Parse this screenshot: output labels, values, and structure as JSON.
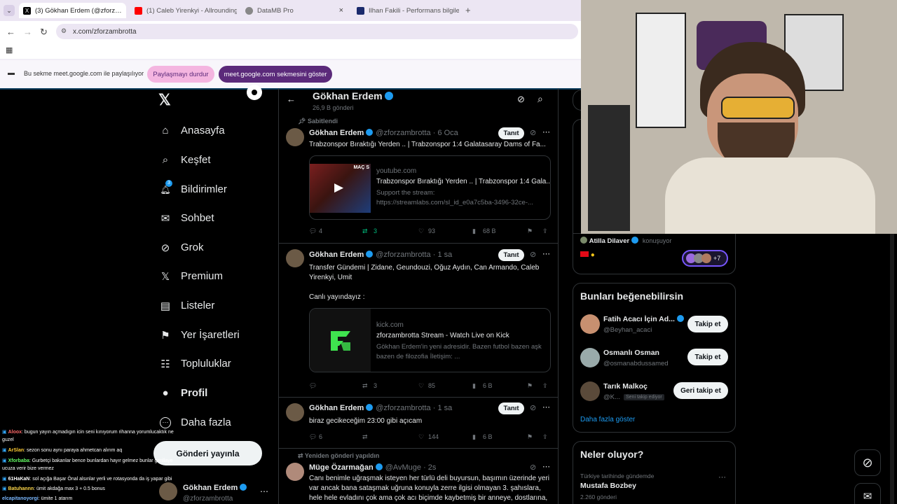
{
  "browser": {
    "tabs": [
      {
        "label": "(3) Gökhan Erdem (@zforz…",
        "favicon_color": "#000000"
      },
      {
        "label": "(1) Caleb Yirenkyi - Allrounding",
        "favicon_color": "#ff0000"
      },
      {
        "label": "DataMB Pro",
        "favicon_color": "#777777"
      },
      {
        "label": "Ilhan Fakili - Performans bilgile…",
        "favicon_color": "#1a2a6c"
      }
    ],
    "new_tab": "+",
    "url": "x.com/zforzambrotta",
    "share_text": "Bu sekme meet.google.com ile paylaşılıyor",
    "stop_share_label": "Paylaşmayı durdur",
    "show_tab_label": "meet.google.com sekmesini göster"
  },
  "sidebar": {
    "items": [
      {
        "label": "Anasayfa",
        "icon": "home-icon",
        "glyph": "⌂"
      },
      {
        "label": "Keşfet",
        "icon": "search-icon",
        "glyph": "⌕"
      },
      {
        "label": "Bildirimler",
        "icon": "bell-icon",
        "glyph": "🔔︎"
      },
      {
        "label": "Sohbet",
        "icon": "mail-icon",
        "glyph": "✉"
      },
      {
        "label": "Grok",
        "icon": "grok-icon",
        "glyph": "⊘"
      },
      {
        "label": "Premium",
        "icon": "x-logo-icon",
        "glyph": "𝕏"
      },
      {
        "label": "Listeler",
        "icon": "list-icon",
        "glyph": "▤"
      },
      {
        "label": "Yer İşaretleri",
        "icon": "bookmark-icon",
        "glyph": "⚑"
      },
      {
        "label": "Topluluklar",
        "icon": "community-icon",
        "glyph": "☷"
      },
      {
        "label": "Profil",
        "icon": "profile-icon",
        "glyph": "●"
      },
      {
        "label": "Daha fazla",
        "icon": "more-icon",
        "glyph": "⋯"
      }
    ],
    "notification_badge": "3",
    "post_button": "Gönderi yayınla",
    "account_name": "Gökhan Erdem",
    "account_handle": "@zforzambrotta"
  },
  "profile_header": {
    "name": "Gökhan Erdem",
    "posts_count": "26,9 B gönderi"
  },
  "tweets": [
    {
      "pinned_label": "Sabitlendi",
      "name": "Gökhan Erdem",
      "handle": "@zforzambrotta",
      "time": "· 6 Oca",
      "tanit": "Tanıt",
      "text": "Trabzonspor Bıraktığı Yerden .. | Trabzonspor 1:4 Galatasaray Dams of Fa...",
      "card": {
        "domain": "youtube.com",
        "title": "Trabzonspor Bıraktığı Yerden .. | Trabzonspor 1:4 Gala...",
        "desc": "Support the stream: https://streamlabs.com/sl_id_e0a7c5ba-3496-32ce-...",
        "thumb_text": "MAÇ S"
      },
      "replies": "4",
      "reposts": "3",
      "likes": "93",
      "views": "68 B"
    },
    {
      "name": "Gökhan Erdem",
      "handle": "@zforzambrotta",
      "time": "· 1 sa",
      "tanit": "Tanıt",
      "text1": "Transfer Gündemi | Zidane, Geundouzi, Oğuz Aydın, Can Armando, Caleb Yirenkyi, Umit",
      "text2": "Canlı yayındayız :",
      "card": {
        "domain": "kick.com",
        "title": "zforzambrotta Stream - Watch Live on Kick",
        "desc": "Gökhan Erdem'in yeni adresidir. Bazen futbol bazen aşk bazen de filozofia İletişim: ..."
      },
      "replies": "",
      "reposts": "3",
      "likes": "85",
      "views": "6 B"
    },
    {
      "name": "Gökhan Erdem",
      "handle": "@zforzambrotta",
      "time": "· 1 sa",
      "tanit": "Tanıt",
      "text": "biraz gecikeceğim 23:00 gibi açıcam",
      "replies": "6",
      "reposts": "",
      "likes": "144",
      "views": "6 B"
    },
    {
      "repost_label": "Yeniden gönderi yapıldın",
      "name": "Müge Özarmağan",
      "handle": "@AvMuge",
      "time": "· 2s",
      "text": "Canı benimle uğraşmak isteyen her türlü deli buyursun, başımın üzerinde yeri var ancak bana sataşmak uğruna konuyla zerre ilgisi olmayan 3. şahıslara, hele hele evladını çok ama çok acı biçimde kaybetmiş bir anneye, dostlarına,"
    }
  ],
  "spaces": {
    "host": "Atilla Dilaver",
    "status": "konuşuyor",
    "extra_count": "+7"
  },
  "who_to_follow": {
    "title": "Bunları beğenebilirsin",
    "users": [
      {
        "name": "Fatih Acacı İçin Ad...",
        "handle": "@Beyhan_acaci",
        "button": "Takip et"
      },
      {
        "name": "Osmanlı Osman",
        "handle": "@osmanabdussamed",
        "button": "Takip et"
      },
      {
        "name": "Tarık Malkoç",
        "handle": "@K...",
        "follows_you": "Seni takip ediyor",
        "button": "Geri takip et"
      }
    ],
    "show_more": "Daha fazla göster"
  },
  "trends": {
    "title": "Neler oluyor?",
    "context": "Türkiye tarihinde gündemde",
    "topic": "Mustafa Bozbey",
    "count": "2.260 gönderi"
  },
  "chat": [
    {
      "user": "Aloox",
      "msg": ": bugun yayın açmadıgın icin seni kınıyorum rihanna yorumlucaktık ne",
      "cont": "guzel"
    },
    {
      "user": "ArSlan",
      "msg": ": sezon sonu aynı paraya ahmetcan alırım aq"
    },
    {
      "user": "Xforbaba",
      "msg": ": Gurbetçi bakanlar bence bunlardan hayır gelmez bunlar gerillaye",
      "cont": "ucuza verir bize vermez"
    },
    {
      "user": "61HaKaN",
      "msg": ": sol açığa Başar Önal alsınlar yerli ve rotasyonda da iş yapar gibi"
    },
    {
      "user": "Batuhannn",
      "msg": ": ümit akdağa max 3 + 0.5 bonus"
    },
    {
      "user": "elcapitanoyorgi",
      "msg": ": ümite 1 atarım"
    }
  ],
  "colors": {
    "accent": "#1d9bf0",
    "repost_green": "#00ba7c",
    "share_pink": "#f4b5e0",
    "share_purple": "#5b2a7a"
  }
}
